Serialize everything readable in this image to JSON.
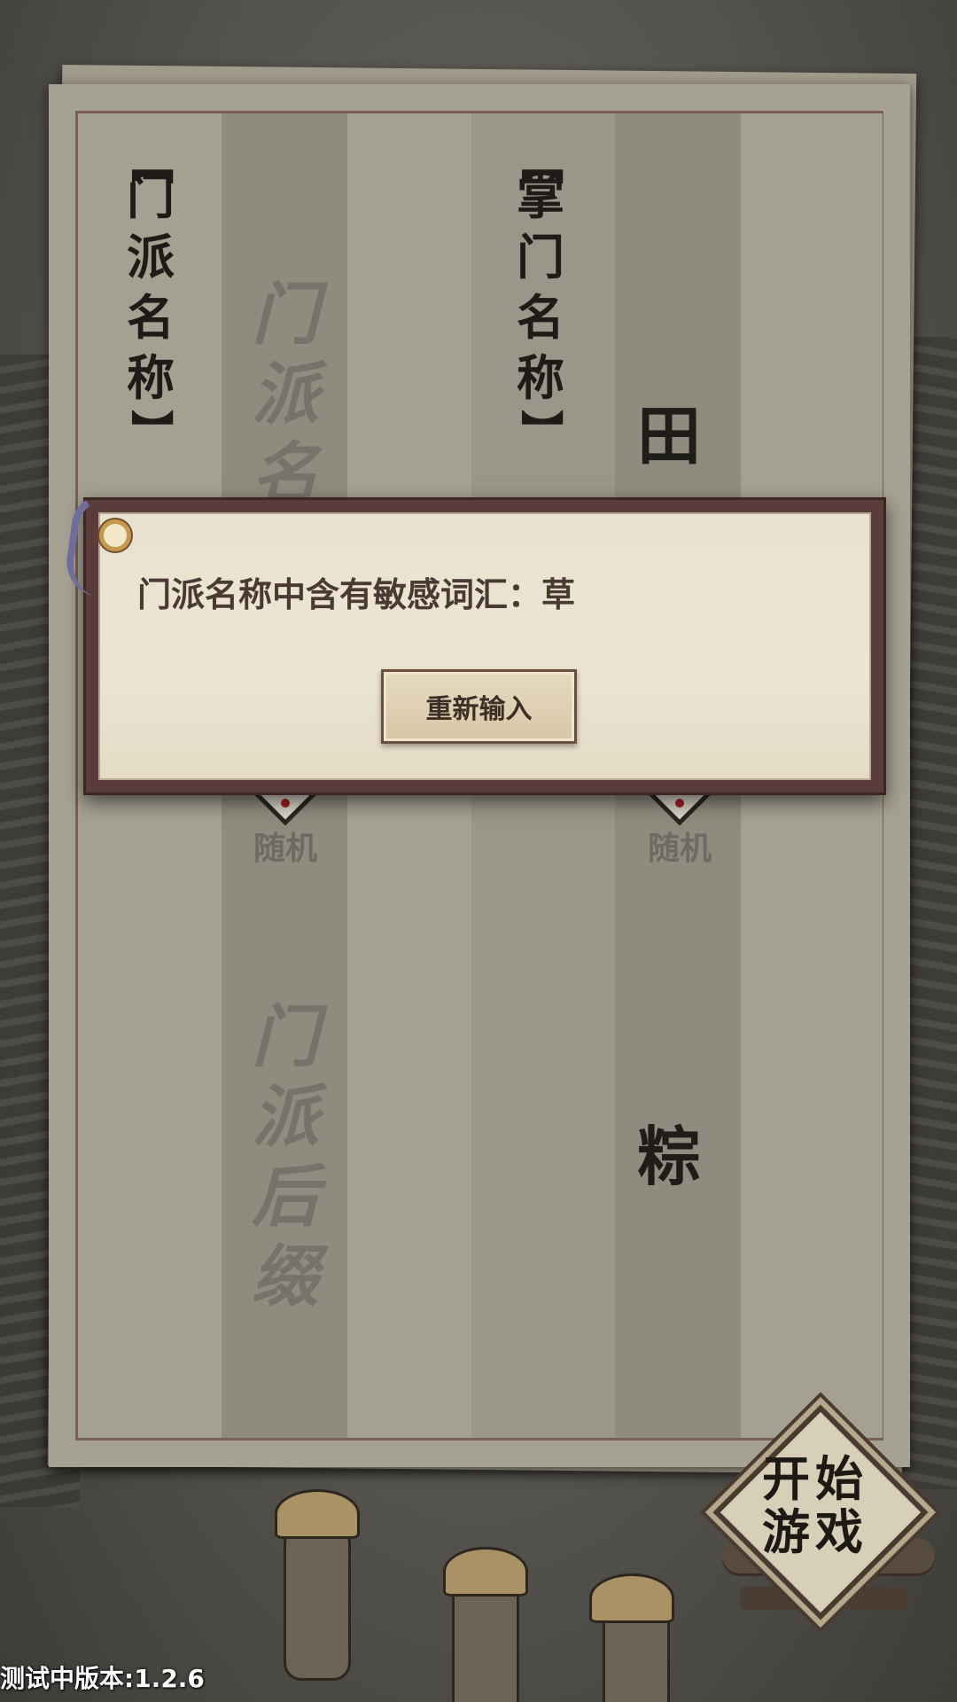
{
  "form": {
    "sect_name_label": [
      "【",
      "门",
      "派",
      "名",
      "称",
      "】"
    ],
    "sect_name_placeholder": [
      "门",
      "派",
      "名"
    ],
    "leader_name_label": [
      "【",
      "掌",
      "门",
      "名",
      "称",
      "】"
    ],
    "leader_name_value": "田",
    "random_left": "随机",
    "random_right": "随机",
    "sect_suffix_placeholder": [
      "门",
      "派",
      "后",
      "缀"
    ],
    "suffix_value": "粽"
  },
  "dialog": {
    "message": "门派名称中含有敏感词汇：草",
    "retry_button": "重新输入"
  },
  "start_button": [
    "开",
    "始",
    "游",
    "戏"
  ],
  "version_text": "测试中版本:1.2.6",
  "colors": {
    "paper": "#a6a293",
    "dialog_bg": "#ece5d3",
    "dialog_frame": "#5a3c3a",
    "text_dark": "#1e1b18"
  }
}
